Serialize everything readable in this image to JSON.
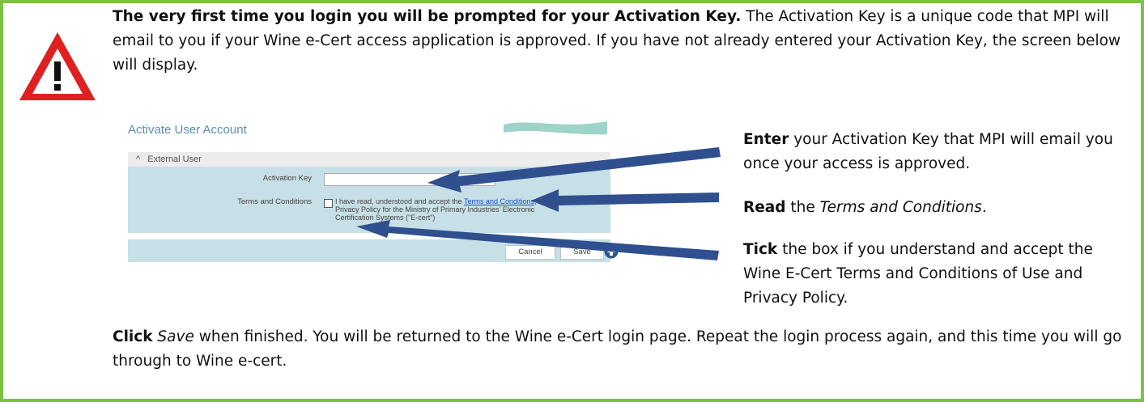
{
  "intro": {
    "bold": "The very first time you login you will be prompted for your Activation Key.",
    "rest": "  The Activation Key is a unique code that MPI will email to you if your Wine e-Cert access application is approved. If you have not already entered your Activation Key, the screen below will display."
  },
  "icon": "warning-triangle-icon",
  "screenshot": {
    "title": "Activate User Account",
    "section": "External User",
    "section_chevron": "^",
    "activation_label": "Activation Key",
    "required_mark": "*",
    "terms_label": "Terms and Conditions",
    "terms_text_before": "I have read, understood and accept the ",
    "terms_link": "Terms and Conditions",
    "terms_text_after": "; of Privacy Policy for the Ministry of Primary Industries' Electronic Certification Systems (\"E-cert\")",
    "cancel": "Cancel",
    "save": "Save"
  },
  "notes": [
    {
      "bold": "Enter",
      "text": " your Activation Key that MPI will email you once your access is approved."
    },
    {
      "bold": "Read",
      "text_before": " the ",
      "italic": "Terms and Conditions",
      "text_after": "."
    },
    {
      "bold": "Tick",
      "text": " the box if you understand and accept the Wine E-Cert Terms and Conditions of Use and Privacy Policy."
    }
  ],
  "outro": {
    "bold": "Click",
    "italic": "Save",
    "rest": " when finished. You will be returned to the Wine e-Cert login page. Repeat the login process again, and this time you will go through to Wine e-cert."
  },
  "colors": {
    "border": "#7cc142",
    "arrow": "#2f4f8f",
    "warning": "#e02020",
    "panel": "#c7dfe6"
  }
}
